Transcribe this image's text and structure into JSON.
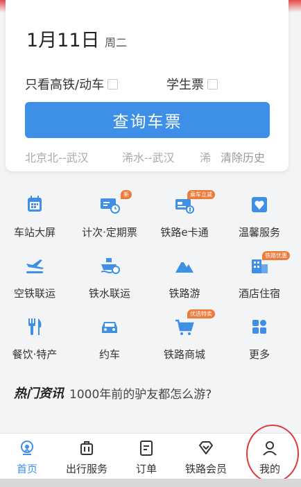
{
  "search": {
    "date": "1月11日",
    "weekday": "周二",
    "option_gaotie": "只看高铁/动车",
    "option_student": "学生票",
    "query_button": "查询车票",
    "history": [
      "北京北--武汉",
      "浠水--武汉",
      "浠"
    ],
    "clear_history": "清除历史"
  },
  "services": [
    {
      "label": "车站大屏",
      "icon": "station-screen-icon"
    },
    {
      "label": "计次·定期票",
      "icon": "ticket-card-icon",
      "badge": "新"
    },
    {
      "label": "铁路e卡通",
      "icon": "ecard-icon",
      "badge": "乘车立减"
    },
    {
      "label": "温馨服务",
      "icon": "heart-service-icon"
    },
    {
      "label": "空铁联运",
      "icon": "plane-train-icon"
    },
    {
      "label": "铁水联运",
      "icon": "ship-train-icon"
    },
    {
      "label": "铁路游",
      "icon": "mountain-icon"
    },
    {
      "label": "酒店住宿",
      "icon": "hotel-icon",
      "badge": "铁路优惠"
    },
    {
      "label": "餐饮·特产",
      "icon": "food-icon"
    },
    {
      "label": "约车",
      "icon": "car-icon"
    },
    {
      "label": "铁路商城",
      "icon": "shopping-cart-icon",
      "badge": "优选特卖"
    },
    {
      "label": "更多",
      "icon": "more-grid-icon"
    }
  ],
  "news": {
    "title": "热门资讯",
    "headline": "1000年前的驴友都怎么游?"
  },
  "tabs": [
    {
      "label": "首页",
      "icon": "home-icon",
      "active": true
    },
    {
      "label": "出行服务",
      "icon": "luggage-icon"
    },
    {
      "label": "订单",
      "icon": "order-icon"
    },
    {
      "label": "铁路会员",
      "icon": "diamond-icon"
    },
    {
      "label": "我的",
      "icon": "user-icon"
    }
  ],
  "colors": {
    "accent": "#3d8fe8",
    "badge": "#f07a3a",
    "highlight_circle": "#e0393e"
  }
}
